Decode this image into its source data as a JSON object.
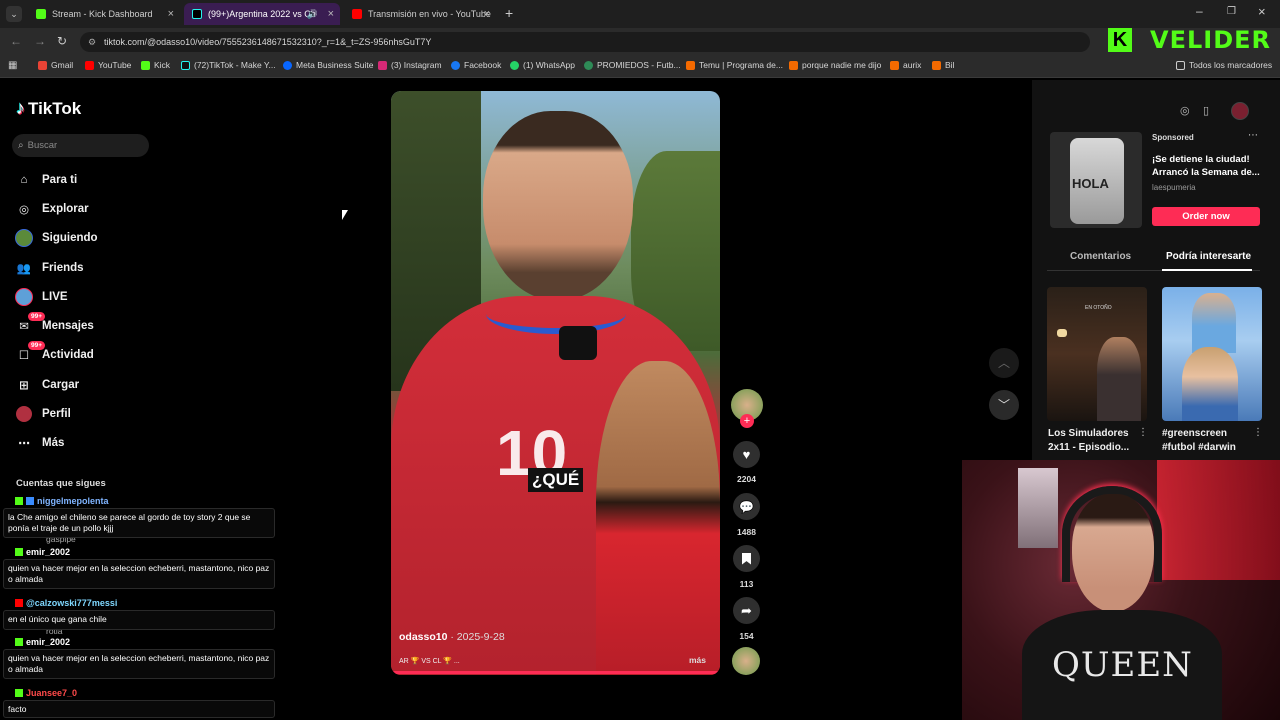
{
  "browser": {
    "tabs": [
      {
        "label": "Stream - Kick Dashboard",
        "active": false
      },
      {
        "label": "(99+)Argentina 2022 vs Ch",
        "active": true
      },
      {
        "label": "Transmisión en vivo - YouTube",
        "active": false
      }
    ],
    "new_tab": "+",
    "url": "tiktok.com/@odasso10/video/7555236148671532310?_r=1&_t=ZS-956nhsGuT7Y",
    "bookmarks": [
      "Gmail",
      "YouTube",
      "Kick",
      "(72)TikTok - Make Y...",
      "Meta Business Suite",
      "(3) Instagram",
      "Facebook",
      "(1) WhatsApp",
      "PROMIEDOS - Futb...",
      "Temu | Programa de...",
      "porque nadie me dijo",
      "aurix",
      "Bil"
    ],
    "all_bookmarks": "Todos los marcadores"
  },
  "kick_logo": "VELIDER",
  "tiktok": {
    "logo": "TikTok",
    "search_placeholder": "Buscar",
    "nav": [
      {
        "label": "Para ti",
        "icon": "home-icon"
      },
      {
        "label": "Explorar",
        "icon": "compass-icon"
      },
      {
        "label": "Siguiendo",
        "icon": "avatar-icon"
      },
      {
        "label": "Friends",
        "icon": "friends-icon"
      },
      {
        "label": "LIVE",
        "icon": "live-icon"
      },
      {
        "label": "Mensajes",
        "icon": "message-icon",
        "badge": "99+"
      },
      {
        "label": "Actividad",
        "icon": "activity-icon",
        "badge": "99+"
      },
      {
        "label": "Cargar",
        "icon": "upload-icon"
      },
      {
        "label": "Perfil",
        "icon": "profile-icon"
      },
      {
        "label": "Más",
        "icon": "more-icon"
      }
    ],
    "following_title": "Cuentas que sigues",
    "video": {
      "author": "odasso10",
      "date": "2025-9-28",
      "caption": "AR 🏆 VS CL 🏆 ...",
      "more": "más",
      "overlay_text": "¿QUÉ",
      "jersey_number": "10"
    },
    "actions": {
      "likes": "2204",
      "comments": "1488",
      "saves": "113",
      "shares": "154"
    },
    "sponsored": {
      "label": "Sponsored",
      "title": "¡Se detiene la ciudad! Arrancó la Semana de...",
      "advertiser": "laespumeria",
      "cta": "Order now",
      "image_text": "HOLA"
    },
    "tabs": [
      "Comentarios",
      "Podría interesarte"
    ],
    "suggested": [
      {
        "title": "Los Simuladores 2x11 - Episodio...",
        "thumb_text": "EN OTOÑO"
      },
      {
        "title": "#greenscreen #futbol #darwin",
        "thumb_text": ""
      }
    ]
  },
  "chat": [
    {
      "user": "niggelmepolenta",
      "color": "#7fb4ff",
      "message": "la Che amigo el chileno se parece al gordo de toy story 2 que se ponía el traje de un pollo kjjj"
    },
    {
      "user": "emir_2002",
      "color": "#ffffff",
      "message": "quien va hacer mejor en la seleccion echeberri, mastantono, nico paz o almada"
    },
    {
      "user": "@calzowski777messi",
      "color": "#7fd8ff",
      "message": "en el único que gana chile"
    },
    {
      "user": "emir_2002",
      "color": "#ffffff",
      "message": "quien va hacer mejor en la seleccion echeberri, mastantono, nico paz o almada"
    },
    {
      "user": "Juansee7_0",
      "color": "#ff4a4a",
      "message": "facto"
    }
  ],
  "background_names": [
    "gaspipe",
    "rotia"
  ],
  "webcam": {
    "shirt_text": "QUEEN"
  },
  "colors": {
    "kick_green": "#53fc18",
    "tiktok_red": "#fe2c55",
    "panel_bg": "#121212"
  }
}
